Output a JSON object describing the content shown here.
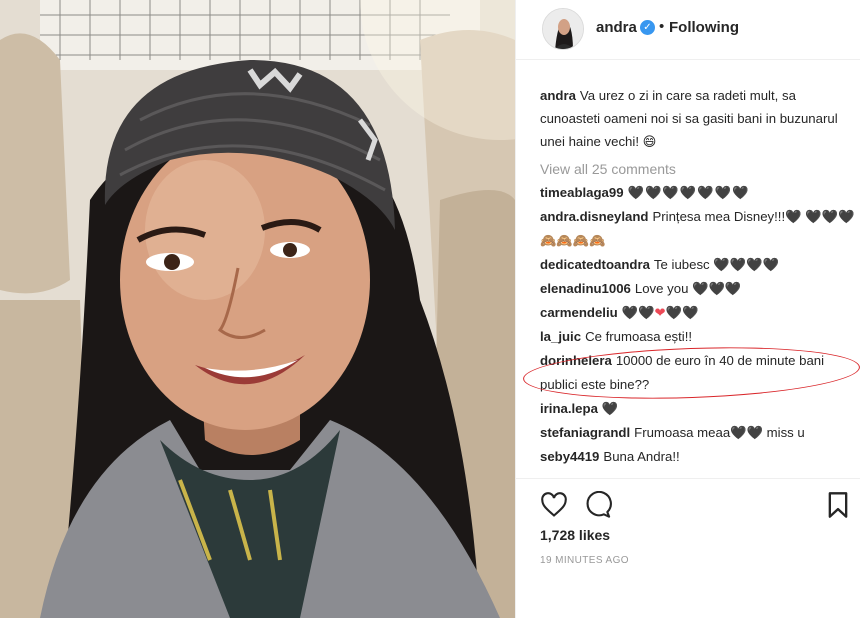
{
  "post": {
    "username": "andra",
    "verified_mark": "✓",
    "separator": "•",
    "follow_status": "Following"
  },
  "caption": {
    "username": "andra",
    "text": "Va urez o zi in care sa radeti mult, sa cunoasteti oameni noi si sa gasiti bani in buzunarul unei haine vechi! 😄"
  },
  "view_all": "View all 25 comments",
  "comments": [
    {
      "user": "timeablaga99",
      "text": "🖤🖤🖤🖤🖤🖤🖤"
    },
    {
      "user": "andra.disneyland",
      "text": "Prințesa mea Disney!!!🖤 🖤🖤🖤🙈🙈🙈🙈"
    },
    {
      "user": "dedicatedtoandra",
      "text": "Te iubesc 🖤🖤🖤🖤"
    },
    {
      "user": "elenadinu1006",
      "text": "Love you 🖤🖤🖤"
    },
    {
      "user": "carmendeliu",
      "text_a": "🖤🖤",
      "text_b": "❤",
      "text_c": "🖤🖤"
    },
    {
      "user": "la_juic",
      "text": "Ce frumoasa ești!!"
    },
    {
      "user": "dorinhelera",
      "text": "10000 de euro în 40 de minute bani publici este bine??"
    },
    {
      "user": "irina.lepa",
      "text": "🖤"
    },
    {
      "user": "stefaniagrandl",
      "text": "Frumoasa meaa🖤🖤 miss u"
    },
    {
      "user": "seby4419",
      "text": "Buna Andra!!"
    }
  ],
  "likes": "1,728 likes",
  "timestamp": "19 MINUTES AGO",
  "icons": {
    "like": "heart-icon",
    "comment": "comment-bubble-icon",
    "save": "bookmark-icon"
  },
  "colors": {
    "verified": "#3897f0",
    "annotation": "#d9262a",
    "muted": "#999999"
  }
}
